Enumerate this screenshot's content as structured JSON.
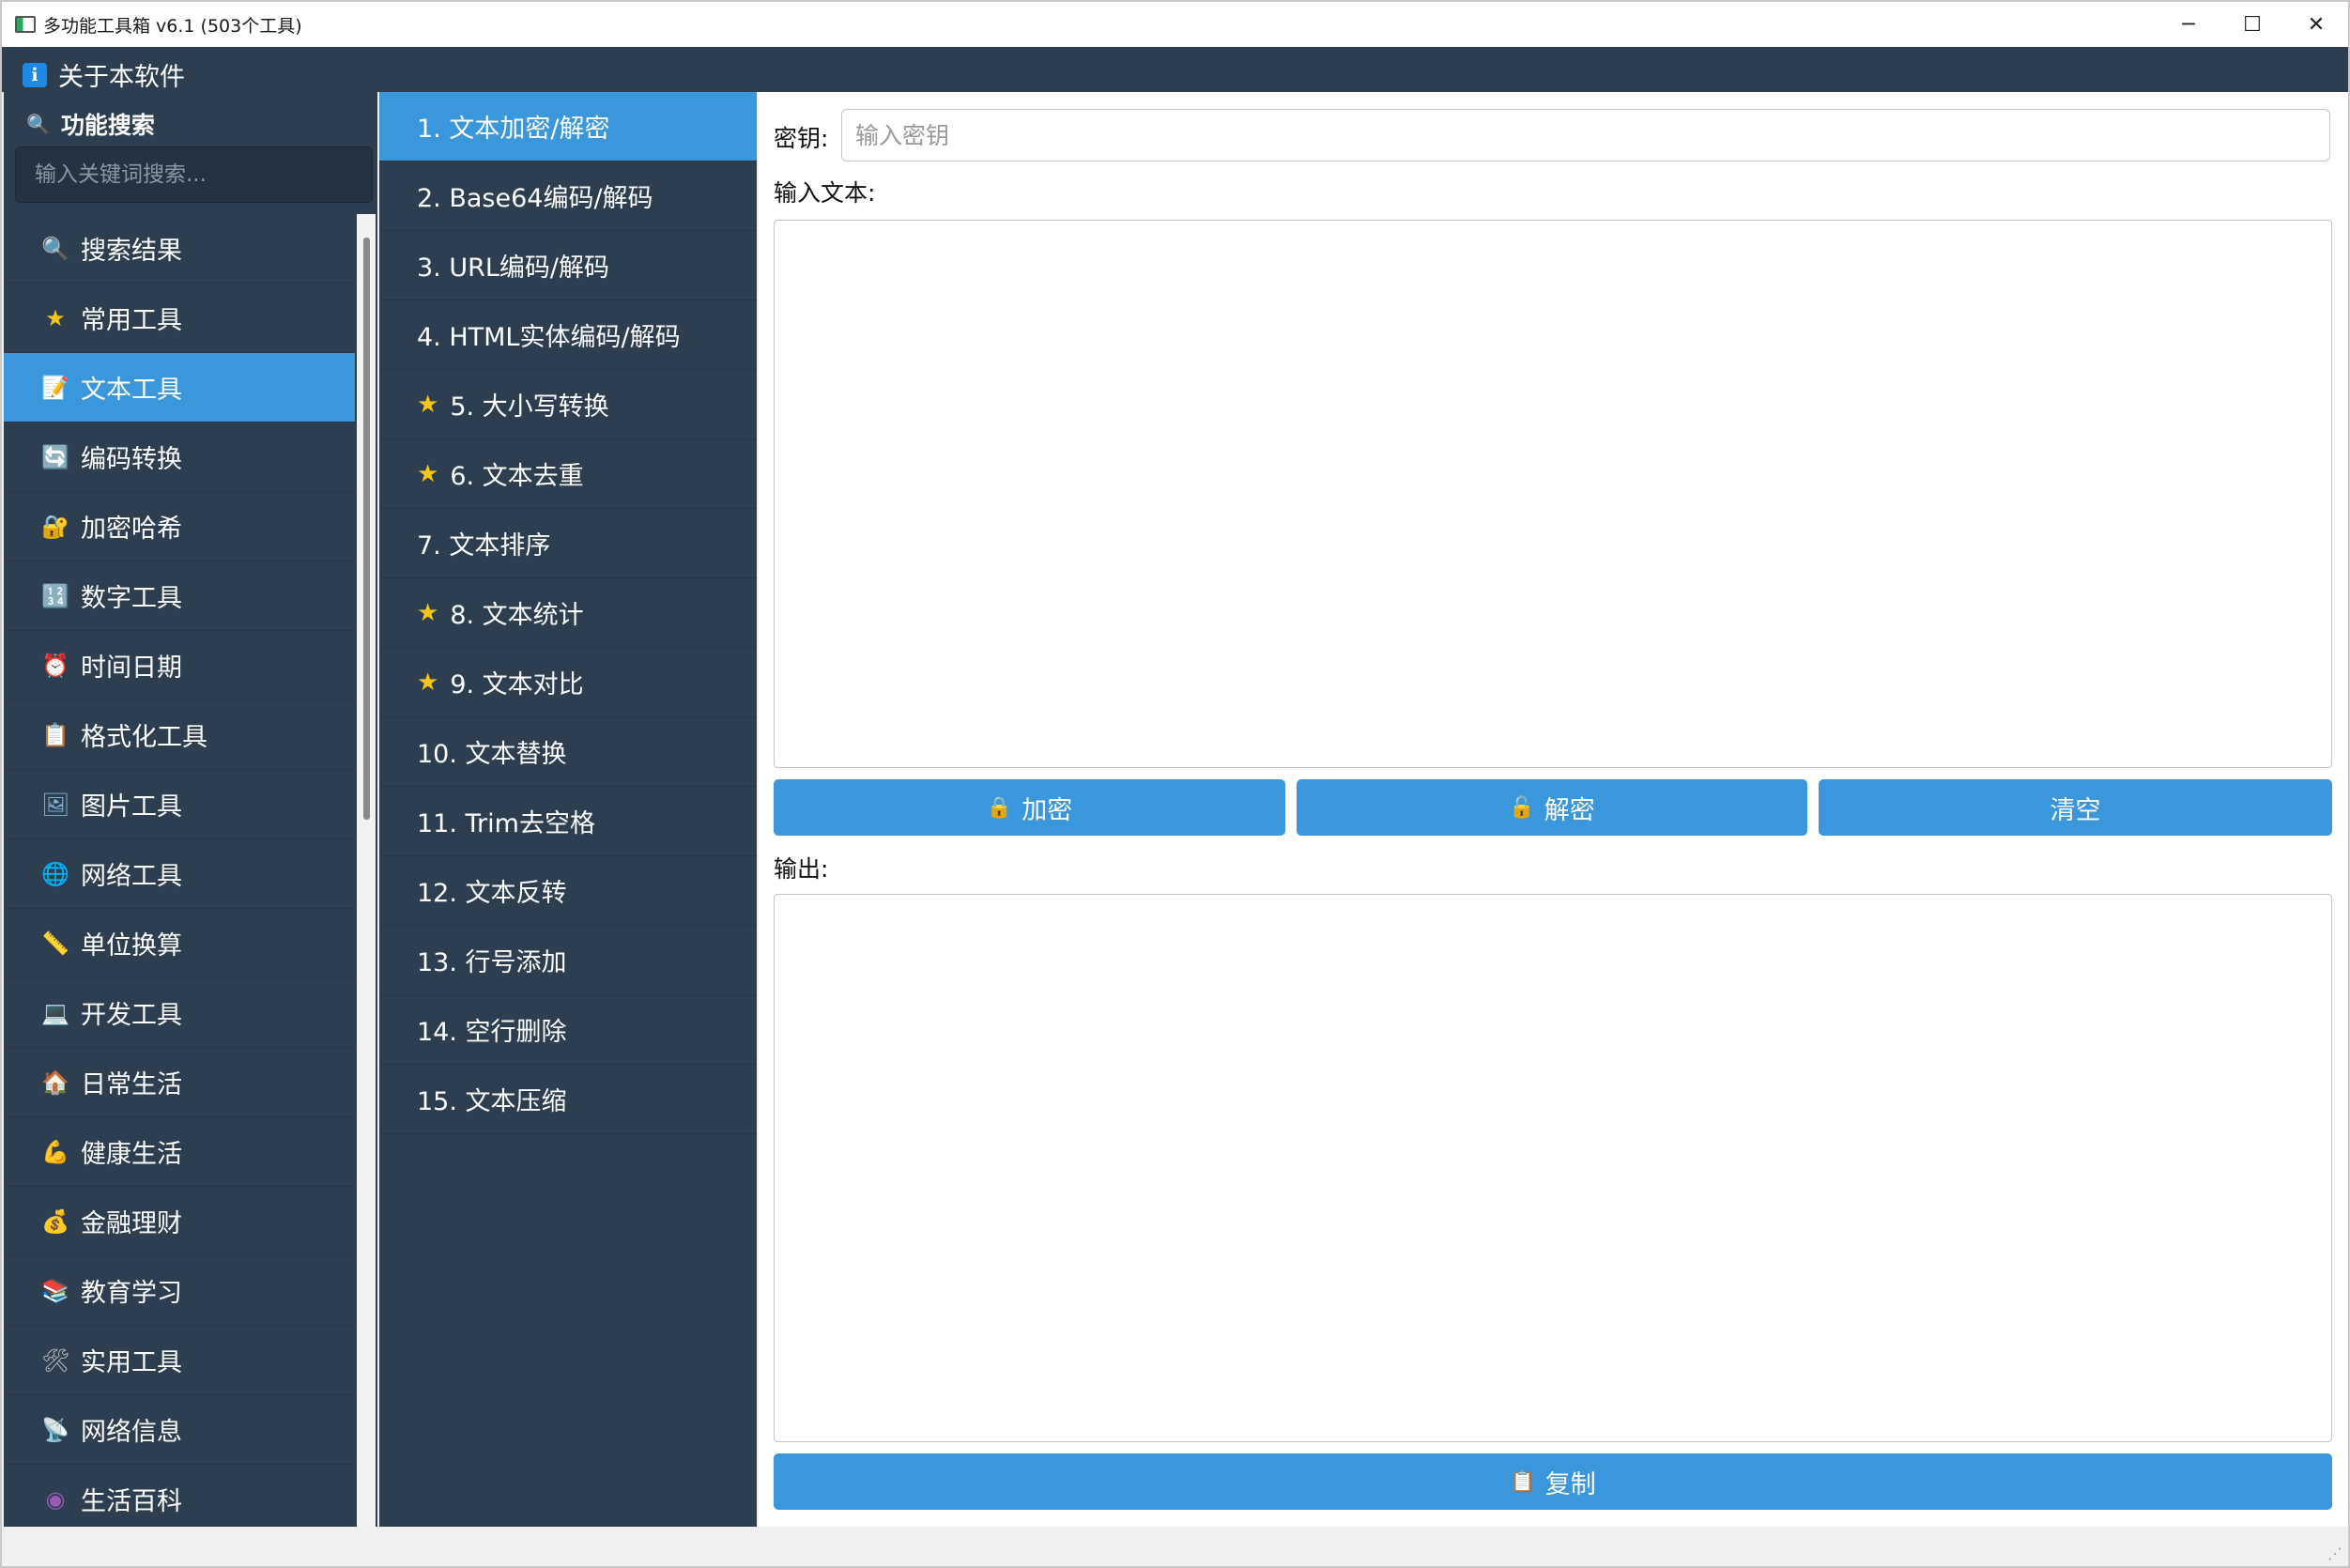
{
  "window": {
    "title": "多功能工具箱 v6.1 (503个工具)",
    "controls": {
      "minimize": "─",
      "maximize": "☐",
      "close": "✕"
    }
  },
  "sidebar": {
    "about_label": "关于本软件",
    "search_heading": "功能搜索",
    "search_placeholder": "输入关键词搜索...",
    "categories": [
      {
        "label": "搜索结果",
        "icon": "magnifier-icon",
        "glyph": "🔍",
        "color": "#5dade2"
      },
      {
        "label": "常用工具",
        "icon": "star-icon",
        "glyph": "★",
        "color": "#f5c518"
      },
      {
        "label": "文本工具",
        "icon": "memo-icon",
        "glyph": "📝",
        "color": "#ffffff"
      },
      {
        "label": "编码转换",
        "icon": "refresh-icon",
        "glyph": "🔄",
        "color": "#2196f3"
      },
      {
        "label": "加密哈希",
        "icon": "lock-icon",
        "glyph": "🔐",
        "color": "#f5b041"
      },
      {
        "label": "数字工具",
        "icon": "numbers-icon",
        "glyph": "🔢",
        "color": "#2196f3"
      },
      {
        "label": "时间日期",
        "icon": "alarm-clock-icon",
        "glyph": "⏰",
        "color": "#e74c3c"
      },
      {
        "label": "格式化工具",
        "icon": "clipboard-icon",
        "glyph": "📋",
        "color": "#f0e6d2"
      },
      {
        "label": "图片工具",
        "icon": "picture-icon",
        "glyph": "🖼",
        "color": "#7fb3d5"
      },
      {
        "label": "网络工具",
        "icon": "globe-icon",
        "glyph": "🌐",
        "color": "#5dade2"
      },
      {
        "label": "单位换算",
        "icon": "ruler-icon",
        "glyph": "📏",
        "color": "#bbbbbb"
      },
      {
        "label": "开发工具",
        "icon": "laptop-icon",
        "glyph": "💻",
        "color": "#5dade2"
      },
      {
        "label": "日常生活",
        "icon": "house-icon",
        "glyph": "🏠",
        "color": "#e67e22"
      },
      {
        "label": "健康生活",
        "icon": "flexed-biceps-icon",
        "glyph": "💪",
        "color": "#f5c518"
      },
      {
        "label": "金融理财",
        "icon": "money-bag-icon",
        "glyph": "💰",
        "color": "#d4a017"
      },
      {
        "label": "教育学习",
        "icon": "books-icon",
        "glyph": "📚",
        "color": "#27ae60"
      },
      {
        "label": "实用工具",
        "icon": "hammer-wrench-icon",
        "glyph": "🛠",
        "color": "#bbbbbb"
      },
      {
        "label": "网络信息",
        "icon": "satellite-dish-icon",
        "glyph": "📡",
        "color": "#bbbbbb"
      },
      {
        "label": "生活百科",
        "icon": "disc-icon",
        "glyph": "◉",
        "color": "#9b59b6"
      }
    ],
    "active_category_index": 2
  },
  "tools": [
    {
      "label": "1. 文本加密/解密",
      "starred": false
    },
    {
      "label": "2. Base64编码/解码",
      "starred": false
    },
    {
      "label": "3. URL编码/解码",
      "starred": false
    },
    {
      "label": "4. HTML实体编码/解码",
      "starred": false
    },
    {
      "label": "5. 大小写转换",
      "starred": true
    },
    {
      "label": "6. 文本去重",
      "starred": true
    },
    {
      "label": "7. 文本排序",
      "starred": false
    },
    {
      "label": "8. 文本统计",
      "starred": true
    },
    {
      "label": "9. 文本对比",
      "starred": true
    },
    {
      "label": "10. 文本替换",
      "starred": false
    },
    {
      "label": "11. Trim去空格",
      "starred": false
    },
    {
      "label": "12. 文本反转",
      "starred": false
    },
    {
      "label": "13. 行号添加",
      "starred": false
    },
    {
      "label": "14. 空行删除",
      "starred": false
    },
    {
      "label": "15. 文本压缩",
      "starred": false
    }
  ],
  "active_tool_index": 0,
  "main": {
    "key_label": "密钥:",
    "key_placeholder": "输入密钥",
    "key_value": "",
    "input_label": "输入文本:",
    "input_value": "",
    "encrypt_label": "加密",
    "decrypt_label": "解密",
    "clear_label": "清空",
    "output_label": "输出:",
    "output_value": "",
    "copy_label": "复制"
  },
  "colors": {
    "sidebar_bg": "#2c3e50",
    "accent": "#3a97db",
    "star": "#f5c518"
  }
}
